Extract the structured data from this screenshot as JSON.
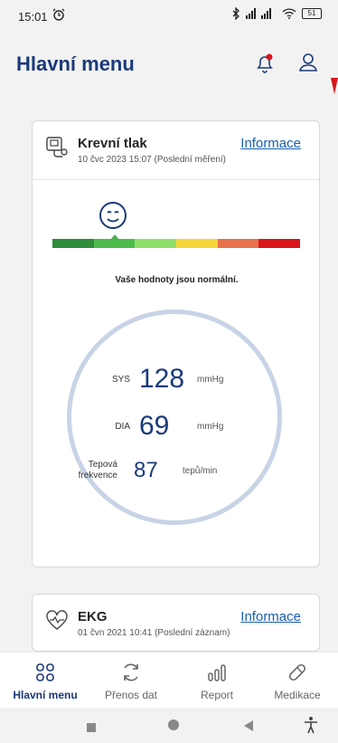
{
  "status_bar": {
    "time": "15:01",
    "battery": "51"
  },
  "header": {
    "title": "Hlavní menu"
  },
  "icons": {
    "alarm": "alarm-icon",
    "bluetooth": "bluetooth-icon",
    "signal": "signal-icon",
    "wifi": "wifi-icon",
    "battery": "battery-icon",
    "bell": "notification-bell-icon",
    "user": "user-icon"
  },
  "blood_pressure": {
    "title": "Krevní tlak",
    "subtitle": "10 čvc 2023 15:07 (Poslední měření)",
    "link": "Informace",
    "status_message": "Vaše hodnoty jsou normální.",
    "scale_colors": [
      "#2e8b3a",
      "#4cbb4c",
      "#8ee06a",
      "#f4d63a",
      "#e8704a",
      "#d9141a"
    ],
    "level_index": 1,
    "sys": {
      "label": "SYS",
      "value": "128",
      "unit": "mmHg"
    },
    "dia": {
      "label": "DIA",
      "value": "69",
      "unit": "mmHg"
    },
    "pulse": {
      "label_line1": "Tepová",
      "label_line2": "frekvence",
      "value": "87",
      "unit": "tepů/min"
    }
  },
  "ekg": {
    "title": "EKG",
    "subtitle": "01 čvn 2021 10:41 (Poslední záznam)",
    "link": "Informace"
  },
  "bottom_nav": [
    {
      "label": "Hlavní menu",
      "icon": "grid-icon",
      "active": true
    },
    {
      "label": "Přenos dat",
      "icon": "sync-icon",
      "active": false
    },
    {
      "label": "Report",
      "icon": "chart-icon",
      "active": false
    },
    {
      "label": "Medikace",
      "icon": "pill-icon",
      "active": false
    }
  ],
  "colors": {
    "brand": "#1a3a7a",
    "link": "#1a5fb0",
    "alert": "#d9141a"
  }
}
